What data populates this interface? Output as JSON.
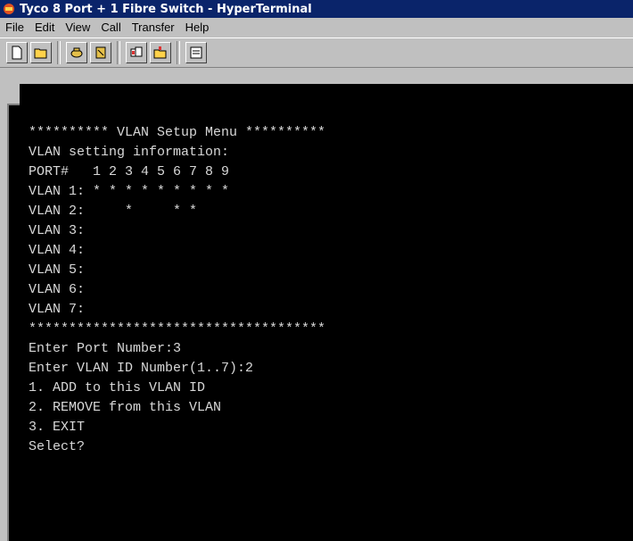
{
  "window": {
    "title": "Tyco 8 Port + 1 Fibre Switch - HyperTerminal"
  },
  "menubar": {
    "items": [
      {
        "label": "File"
      },
      {
        "label": "Edit"
      },
      {
        "label": "View"
      },
      {
        "label": "Call"
      },
      {
        "label": "Transfer"
      },
      {
        "label": "Help"
      }
    ]
  },
  "toolbar": {
    "buttons": [
      {
        "icon": "new-document-icon"
      },
      {
        "icon": "open-folder-icon"
      },
      {
        "icon": "phone-call-icon"
      },
      {
        "icon": "disconnect-icon"
      },
      {
        "icon": "send-icon"
      },
      {
        "icon": "receive-icon"
      },
      {
        "icon": "properties-icon"
      }
    ]
  },
  "terminal": {
    "lines": [
      "",
      "",
      "********** VLAN Setup Menu **********",
      "VLAN setting information:",
      "PORT#   1 2 3 4 5 6 7 8 9",
      "VLAN 1: * * * * * * * * *",
      "VLAN 2:     *     * *",
      "VLAN 3:",
      "VLAN 4:",
      "VLAN 5:",
      "VLAN 6:",
      "VLAN 7:",
      "*************************************",
      "Enter Port Number:3",
      "Enter VLAN ID Number(1..7):2",
      "1. ADD to this VLAN ID",
      "2. REMOVE from this VLAN",
      "3. EXIT",
      "Select?"
    ]
  }
}
